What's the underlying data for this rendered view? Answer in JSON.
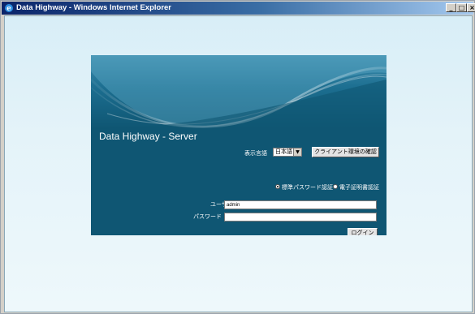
{
  "window": {
    "title": "Data Highway - Windows Internet Explorer"
  },
  "login": {
    "server_title": "Data Highway - Server",
    "display_language_label": "表示言語",
    "language_selected": "日本語",
    "client_env_button": "クライアント環境の確認",
    "auth_standard": "標準パスワード認証",
    "auth_certificate": "電子証明書認証",
    "auth_selected": "standard",
    "userid_label": "ユーザID",
    "userid_value": "admin",
    "password_label": "パスワード",
    "password_value": "",
    "login_button": "ログイン"
  },
  "colors": {
    "panel": "#0f5673",
    "title_bar": "#0a246a"
  }
}
